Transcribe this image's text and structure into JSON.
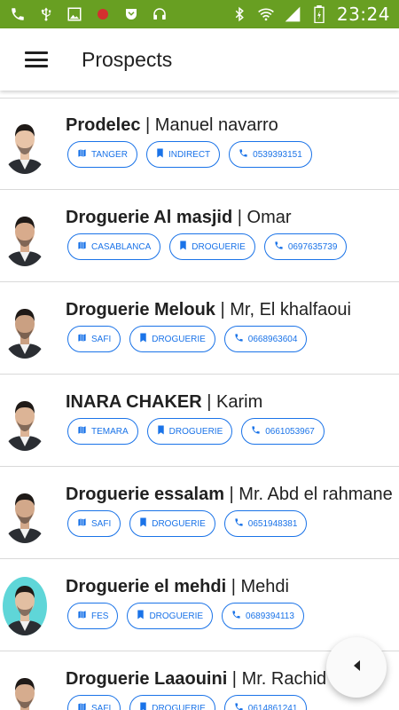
{
  "status_bar": {
    "time": "23:24",
    "left_icons": [
      "phone-icon",
      "usb-icon",
      "image-icon",
      "record-icon",
      "pocket-icon",
      "headset-icon"
    ],
    "right_icons": [
      "bluetooth-icon",
      "wifi-icon",
      "signal-icon",
      "battery-icon"
    ],
    "color": "#689f22"
  },
  "app_bar": {
    "title": "Prospects"
  },
  "colors": {
    "accent": "#1a73e8"
  },
  "prospects": [
    {
      "name": "Prodelec",
      "contact": "Manuel navarro",
      "city": "TANGER",
      "category": "INDIRECT",
      "phone": "0539393151"
    },
    {
      "name": "Droguerie Al masjid",
      "contact": "Omar",
      "city": "CASABLANCA",
      "category": "DROGUERIE",
      "phone": "0697635739"
    },
    {
      "name": "Droguerie Melouk",
      "contact": "Mr, El khalfaoui",
      "city": "SAFI",
      "category": "DROGUERIE",
      "phone": "0668963604"
    },
    {
      "name": "INARA CHAKER",
      "contact": "Karim",
      "city": "TEMARA",
      "category": "DROGUERIE",
      "phone": "0661053967"
    },
    {
      "name": "Droguerie essalam",
      "contact": "Mr. Abd el rahmane",
      "city": "SAFI",
      "category": "DROGUERIE",
      "phone": "0651948381"
    },
    {
      "name": "Droguerie el mehdi",
      "contact": "Mehdi",
      "city": "FES",
      "category": "DROGUERIE",
      "phone": "0689394113"
    },
    {
      "name": "Droguerie Laaouini",
      "contact": "Mr. Rachid",
      "city": "SAFI",
      "category": "DROGUERIE",
      "phone": "0614861241"
    }
  ],
  "fab": {
    "icon": "arrow-left-icon"
  }
}
